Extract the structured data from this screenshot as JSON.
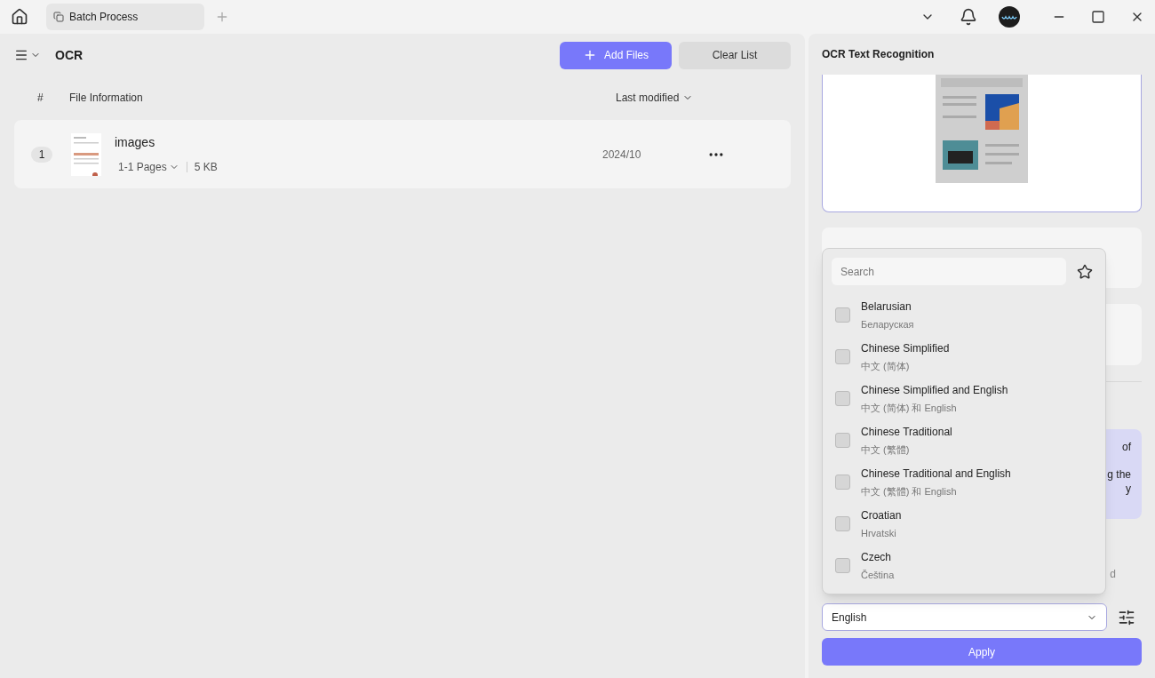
{
  "topbar": {
    "tab": {
      "label": "Batch Process"
    }
  },
  "toolbar": {
    "title": "OCR",
    "buttons": [
      {
        "label": "Add Files",
        "kind": "primary"
      },
      {
        "label": "Clear List",
        "kind": "secondary"
      }
    ]
  },
  "table": {
    "columns": [
      "#",
      "File Information",
      "Last modified"
    ],
    "rows": [
      {
        "index": "1",
        "name": "images",
        "pages": "1-1 Pages",
        "size": "5 KB",
        "date": "2024/10"
      }
    ]
  },
  "panel": {
    "title": "OCR Text Recognition",
    "note_fragments": [
      "of",
      "g the",
      "y"
    ],
    "hint_fragment": "d",
    "language": "English",
    "apply": "Apply"
  },
  "dropdown": {
    "search_placeholder": "Search",
    "items": [
      {
        "name": "Belarusian",
        "native": "Беларуская",
        "checked": false
      },
      {
        "name": "Chinese Simplified",
        "native": "中文 (简体)",
        "checked": false
      },
      {
        "name": "Chinese Simplified and English",
        "native": "中文 (简体) 和 English",
        "checked": false
      },
      {
        "name": "Chinese Traditional",
        "native": "中文 (繁體)",
        "checked": false
      },
      {
        "name": "Chinese Traditional and English",
        "native": "中文 (繁體) 和 English",
        "checked": false
      },
      {
        "name": "Croatian",
        "native": "Hrvatski",
        "checked": false
      },
      {
        "name": "Czech",
        "native": "Čeština",
        "checked": false
      }
    ]
  }
}
